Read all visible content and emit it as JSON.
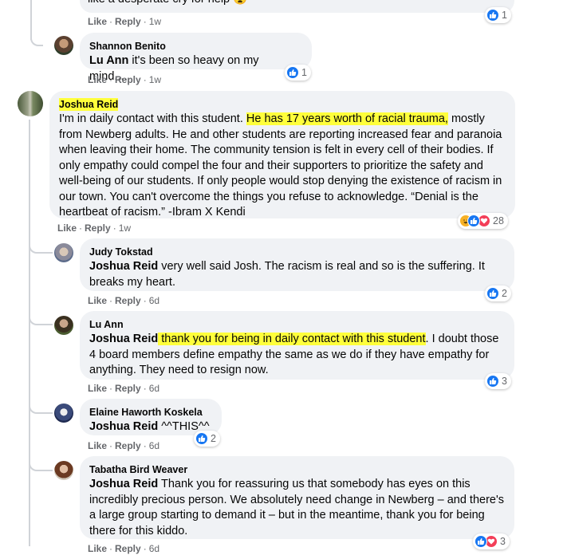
{
  "actions": {
    "like": "Like",
    "reply": "Reply"
  },
  "comments": [
    {
      "author": "",
      "mention": "",
      "text": "like a desperate cry for help 😧",
      "time": "1w",
      "reactions": "1"
    },
    {
      "author": "Shannon Benito",
      "mention": "Lu Ann",
      "text": " it's been so heavy on my mind.....",
      "time": "1w",
      "reactions": "1"
    },
    {
      "author": "Joshua Reid",
      "text_parts": [
        "I'm in daily contact with this student. ",
        "He has 17 years worth of racial trauma,",
        " mostly from Newberg adults. He and other students are reporting increased fear and paranoia when leaving their home. The community tension is felt in every cell of their bodies. If only empathy could compel the four and their supporters to prioritize the safety and well-being of our students. If only people would stop denying the existence of racism in our town. You can't overcome the things you refuse to acknowledge. “Denial is the heartbeat of racism.” -Ibram X Kendi"
      ],
      "time": "1w",
      "reactions": "28"
    },
    {
      "author": "Judy Tokstad",
      "mention": "Joshua Reid",
      "text": " very well said Josh. The racism is real and so is the suffering. It breaks my heart.",
      "time": "6d",
      "reactions": "2"
    },
    {
      "author": "Lu Ann",
      "mention": "Joshua Reid",
      "text_hl": " thank you for being in daily contact with this student",
      "text": ". I doubt those 4 board members define empathy the same as we do if they have empathy for anything. They need to resign now.",
      "time": "6d",
      "reactions": "3"
    },
    {
      "author": "Elaine Haworth Koskela",
      "mention": "Joshua Reid",
      "text": " ^^THIS^^",
      "time": "6d",
      "reactions": "2"
    },
    {
      "author": "Tabatha Bird Weaver",
      "mention": "Joshua Reid",
      "text": " Thank you for reassuring us that somebody has eyes on this incredibly precious person. We absolutely need change in Newberg – and there's a large group starting to demand it – but in the meantime, thank you for being there for this kiddo.",
      "time": "6d",
      "reactions": "3"
    }
  ],
  "colors": {
    "like": "#1877f2",
    "love": "#f33e58",
    "haha": "#f7b125",
    "highlight": "#ffff3b"
  }
}
